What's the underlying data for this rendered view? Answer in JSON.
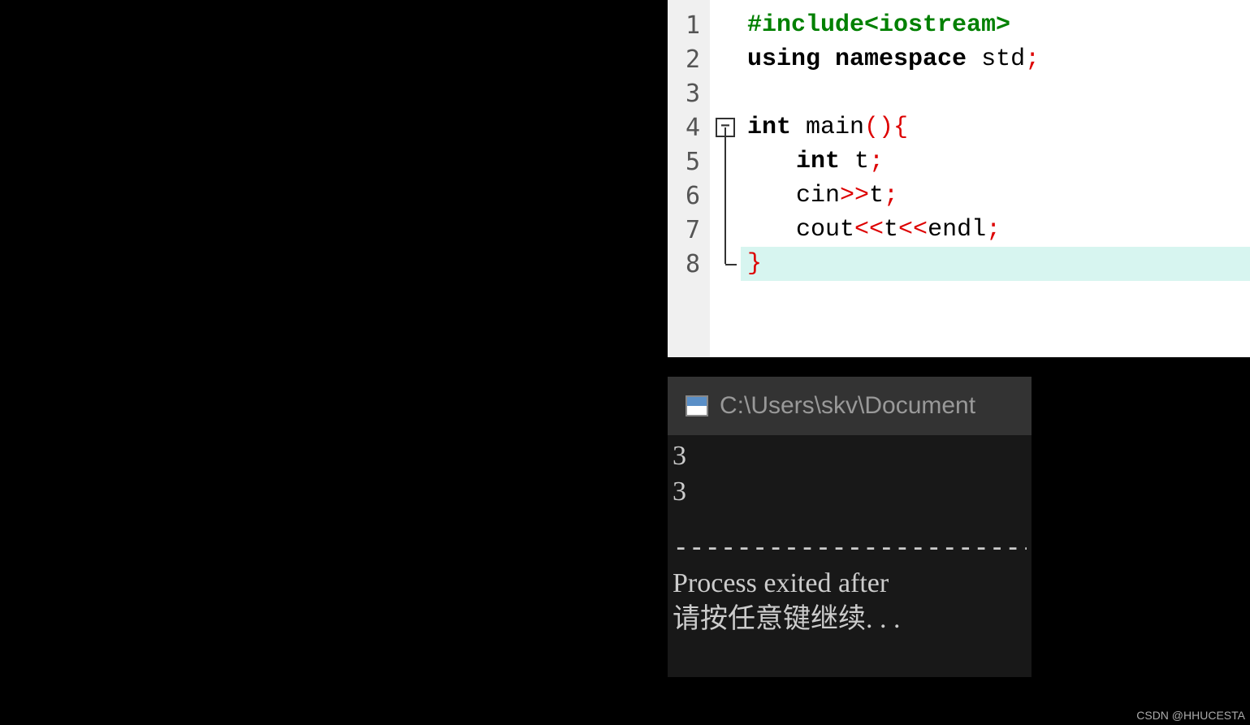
{
  "editor": {
    "lineNumbers": [
      "1",
      "2",
      "3",
      "4",
      "5",
      "6",
      "7",
      "8"
    ],
    "code": {
      "line1": {
        "include": "#include",
        "header": "<iostream>"
      },
      "line2": {
        "using": "using",
        "namespace": "namespace",
        "std": " std",
        "semi": ";"
      },
      "line3": "",
      "line4": {
        "int": "int",
        "main": " main",
        "parens": "()",
        "brace": "{"
      },
      "line5": {
        "int": "int",
        "var": " t",
        "semi": ";"
      },
      "line6": {
        "cin": "cin",
        "op": ">>",
        "var": "t",
        "semi": ";"
      },
      "line7": {
        "cout": "cout",
        "op1": "<<",
        "var": "t",
        "op2": "<<",
        "endl": "endl",
        "semi": ";"
      },
      "line8": {
        "brace": "}"
      }
    },
    "foldMinus": "−"
  },
  "console": {
    "title": "C:\\Users\\skv\\Document",
    "output": [
      "3",
      "3"
    ],
    "divider": "--------------------------------",
    "processMsg": "Process exited after",
    "continueMsg": "请按任意键继续. . ."
  },
  "watermark": "CSDN @HHUCESTA"
}
